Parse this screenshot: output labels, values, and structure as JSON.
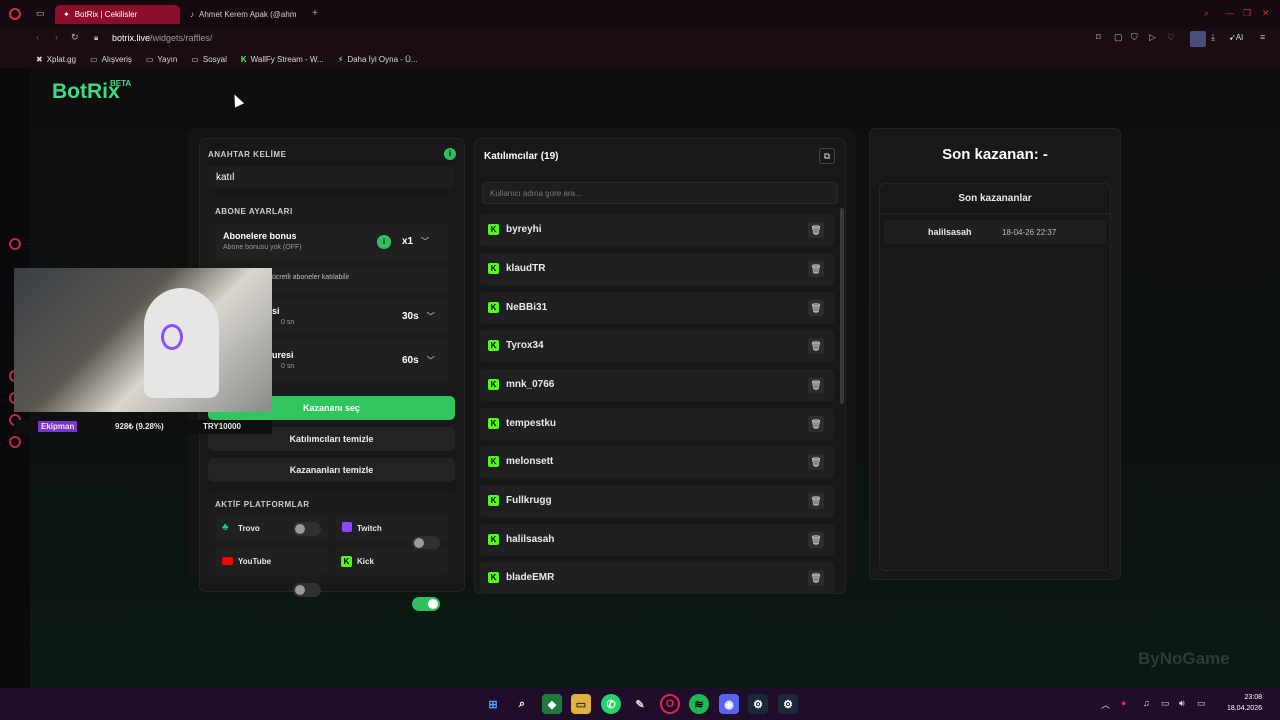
{
  "browser": {
    "tabs": [
      {
        "title": "BotRix | Cekilisler",
        "active": true
      },
      {
        "title": "Ahmet Kerem Apak (@ahm",
        "active": false
      }
    ],
    "new_tab": "+",
    "url_host": "botrix.live",
    "url_path": "/widgets/raffles/",
    "toolbar_ai": "AI",
    "bookmarks": [
      "Xplat.gg",
      "Alışveriş",
      "Yayın",
      "Sosyal",
      "WallFy Stream - W...",
      "Daha İyi Oyna - Ü..."
    ]
  },
  "app": {
    "logo": "BotRix",
    "beta": "BETA"
  },
  "settings": {
    "keyword_title": "ANAHTAR KELİME",
    "keyword_value": "katıl",
    "subscriber_title": "ABONE AYARLARI",
    "bonus_label": "Abonelere bonus",
    "bonus_sub": "Abone bonusu yok (OFF)",
    "bonus_value": "x1",
    "subs_only_text": "ücretli aboneler katılabilir",
    "row3_label": "si",
    "row3_sub": "0 sn",
    "row3_value": "30s",
    "row4_label": "uresi",
    "row4_sub": "0 sn",
    "row4_value": "60s",
    "pick_winner": "Kazananı seç",
    "clear_participants": "Katılımcıları temizle",
    "clear_winners": "Kazananları temizle",
    "platforms_title": "AKTİF PLATFORMLAR",
    "platforms": [
      {
        "name": "Trovo",
        "enabled": false,
        "color": "#19d66b"
      },
      {
        "name": "Twitch",
        "enabled": false,
        "color": "#9146ff"
      },
      {
        "name": "YouTube",
        "enabled": false,
        "color": "#ff0000"
      },
      {
        "name": "Kick",
        "enabled": true,
        "color": "#53fc18"
      }
    ]
  },
  "participants": {
    "title": "Katılımcılar (19)",
    "search_placeholder": "Kullanıcı adına gore ara...",
    "list": [
      "byreyhi",
      "klaudTR",
      "NeBBi31",
      "Tyrox34",
      "mnk_0766",
      "tempestku",
      "melonsett",
      "Fullkrugg",
      "halilsasah",
      "bladeEMR"
    ]
  },
  "winners": {
    "last_winner": "Son kazanan: -",
    "recent_title": "Son kazananlar",
    "list": [
      {
        "name": "halilsasah",
        "time": "18-04-26 22:37"
      }
    ]
  },
  "overlay": {
    "tag": "Ekipman",
    "stat": "928₺ (9.28%)",
    "goal": "TRY10000",
    "watermark": "ByNoGame"
  },
  "taskbar": {
    "time": "23:08",
    "date": "18.04.2026"
  },
  "colors": {
    "accent": "#3ddc84",
    "kick": "#53fc18",
    "browser_tab": "#8c0e2e"
  }
}
